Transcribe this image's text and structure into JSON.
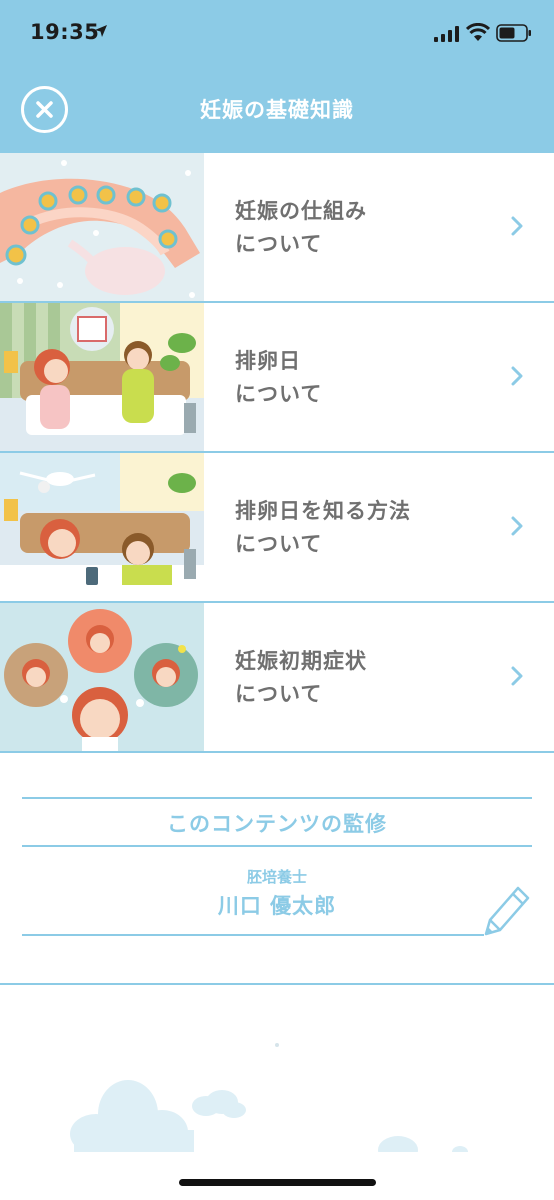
{
  "status_bar": {
    "time": "19:35"
  },
  "header": {
    "title": "妊娠の基礎知識",
    "close_icon": "close-icon"
  },
  "list": {
    "items": [
      {
        "line1": "妊娠の仕組み",
        "line2": "について"
      },
      {
        "line1": "排卵日",
        "line2": "について"
      },
      {
        "line1": "排卵日を知る方法",
        "line2": "について"
      },
      {
        "line1": "妊娠初期症状",
        "line2": "について"
      }
    ]
  },
  "supervisor": {
    "heading": "このコンテンツの監修",
    "role": "胚培養士",
    "name": "川口 優太郎"
  },
  "colors": {
    "accent": "#8ccbe6",
    "text_gray": "#707070",
    "white": "#ffffff"
  }
}
